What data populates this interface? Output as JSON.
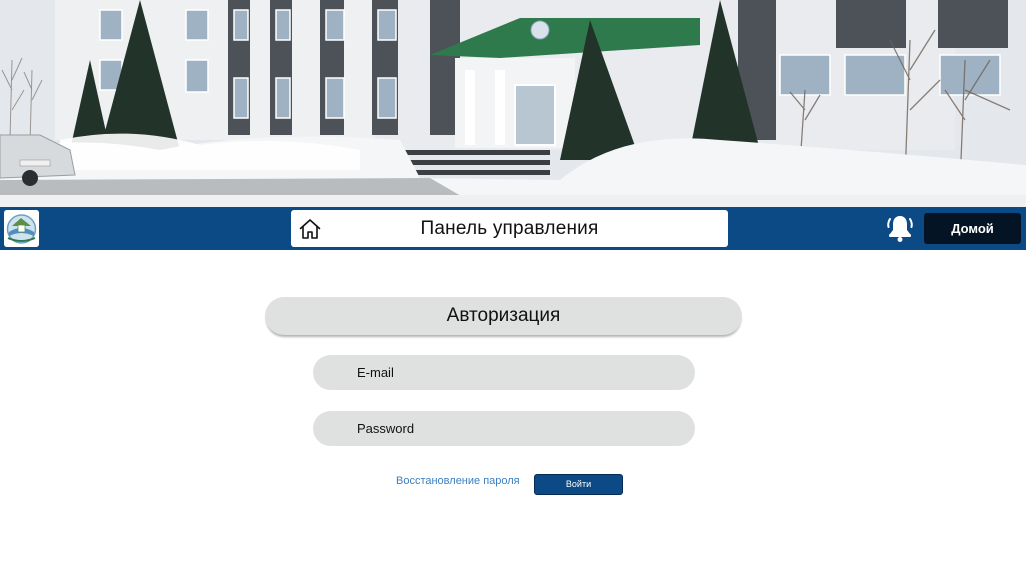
{
  "banner": {
    "image": "administration-building-winter-photo"
  },
  "navbar": {
    "logo": "municipal-emblem-logo",
    "home_icon": "home-icon",
    "title": "Панель управления",
    "bell_icon": "bell-icon",
    "home_button_label": "Домой",
    "color": "#0c4a85"
  },
  "auth": {
    "title": "Авторизация",
    "email_placeholder": "E-mail",
    "email_value": "",
    "password_placeholder": "Password",
    "password_value": "",
    "recover_link": "Восстановление пароля",
    "login_button": "Войти"
  },
  "colors": {
    "primary_blue": "#0c4a85",
    "dark_button": "#041425",
    "field_gray": "#dee1df",
    "link_blue": "#3b7fc0"
  }
}
